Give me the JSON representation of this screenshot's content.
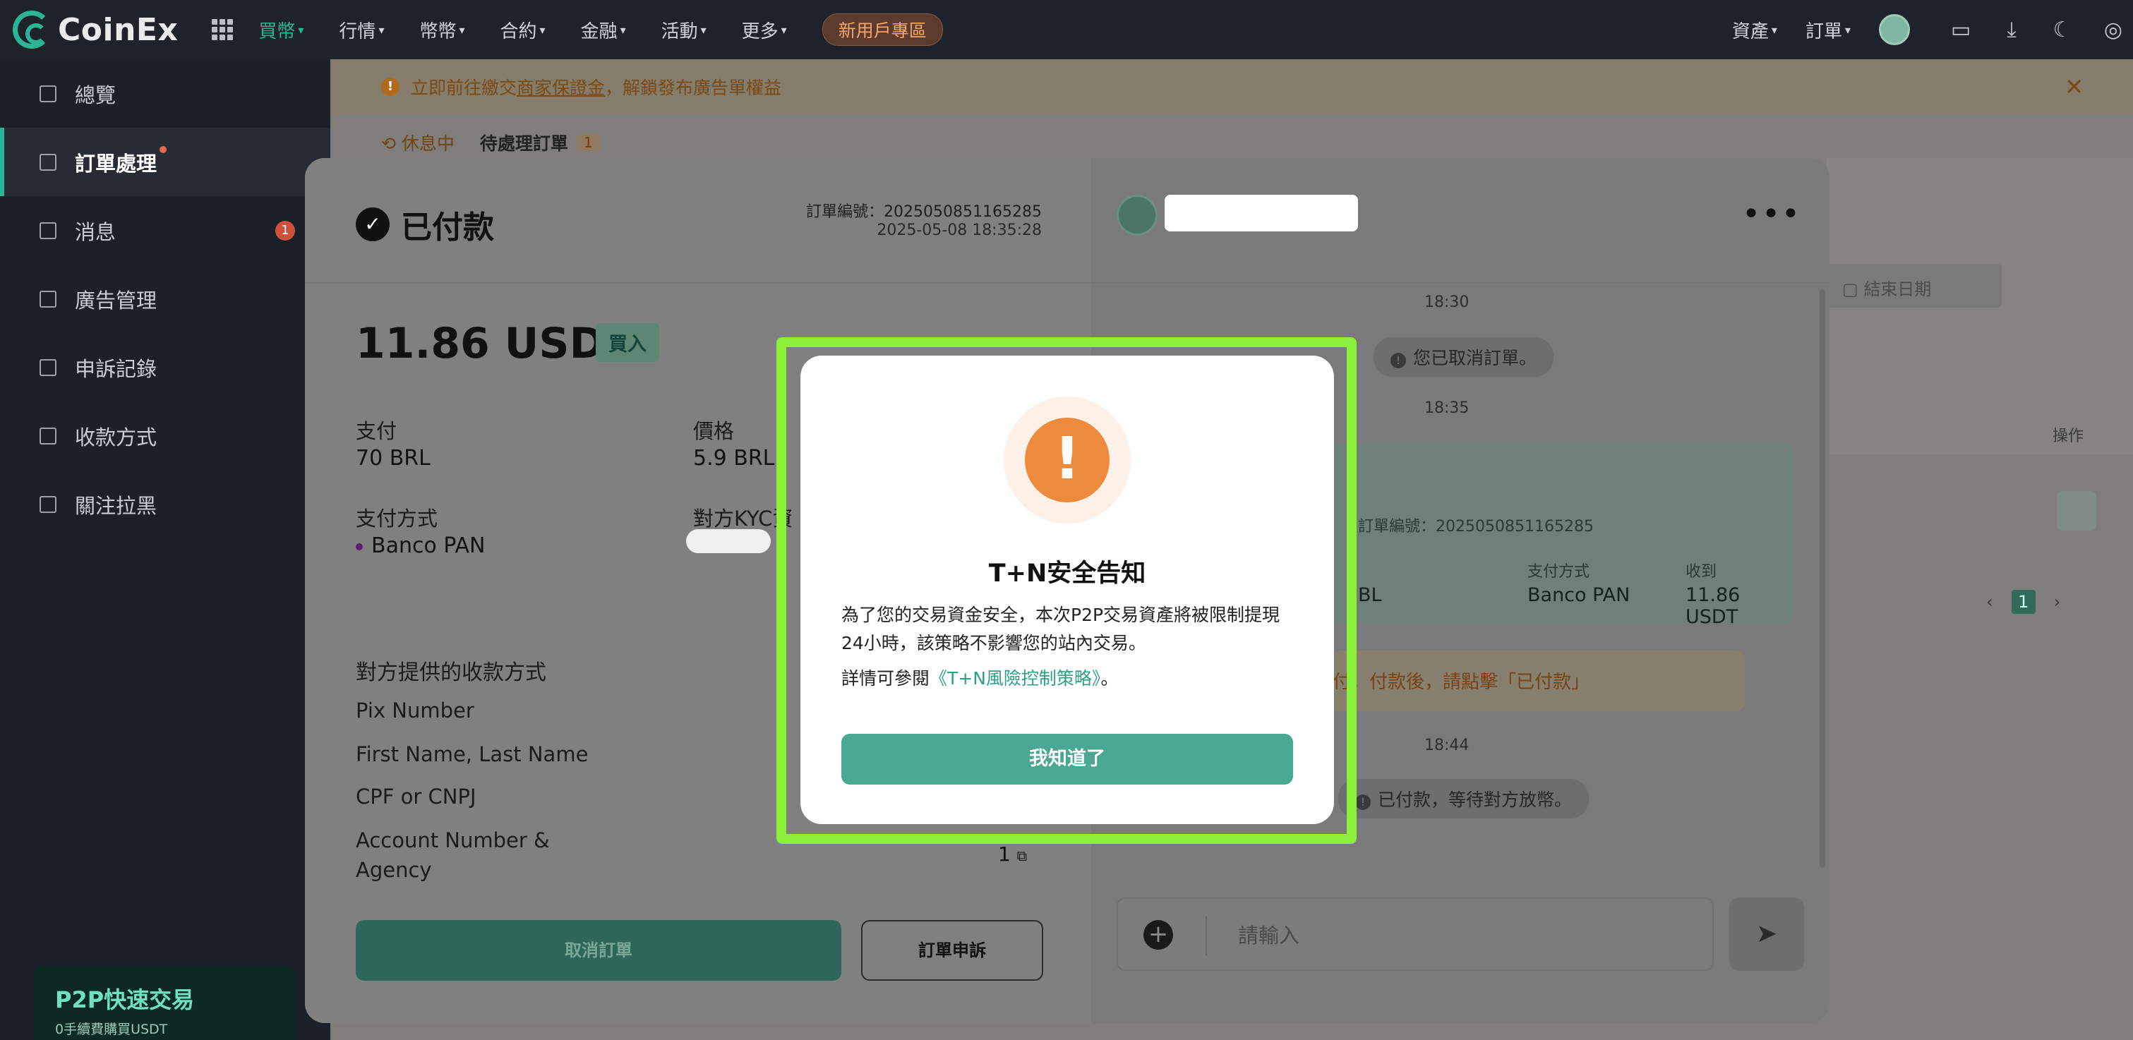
{
  "brand": "CoinEx",
  "topnav": {
    "items": [
      {
        "label": "買幣",
        "active": true
      },
      {
        "label": "行情",
        "active": false
      },
      {
        "label": "幣幣",
        "active": false
      },
      {
        "label": "合約",
        "active": false
      },
      {
        "label": "金融",
        "active": false
      },
      {
        "label": "活動",
        "active": false
      },
      {
        "label": "更多",
        "active": false
      }
    ],
    "new_user": "新用戶專區",
    "right": {
      "assets": "資產",
      "orders": "訂單"
    }
  },
  "sidebar": {
    "items": [
      {
        "label": "總覽"
      },
      {
        "label": "訂單處理"
      },
      {
        "label": "消息",
        "badge": "1"
      },
      {
        "label": "廣告管理"
      },
      {
        "label": "申訴記錄"
      },
      {
        "label": "收款方式"
      },
      {
        "label": "關注拉黑"
      }
    ],
    "promo": {
      "title": "P2P快速交易",
      "subtitle": "0手續費購買USDT"
    }
  },
  "notice": {
    "prefix": "立即前往繳交",
    "link": "商家保證金",
    "suffix": "，解鎖發布廣告單權益"
  },
  "status": {
    "rest": "休息中",
    "pending": "待處理訂單",
    "pending_count": "1"
  },
  "background": {
    "end_date": "結束日期",
    "operation": "操作",
    "page": "1"
  },
  "order": {
    "status_title": "已付款",
    "order_no": "訂單編號：2025050851165285",
    "time": "2025-05-08 18:35:28",
    "amount": "11.86 USDT",
    "side": "買入",
    "pay_label": "支付",
    "pay_value": "70 BRL",
    "price_label": "價格",
    "price_value": "5.9 BRL",
    "method_label": "支付方式",
    "method_value": "Banco PAN",
    "kyc_label": "對方KYC資",
    "payee_title": "對方提供的收款方式",
    "fields": [
      "Pix Number",
      "First Name, Last Name",
      "CPF or CNPJ",
      "Account Number &",
      "Agency"
    ],
    "account_value": "1",
    "cancel": "取消訂單",
    "appeal": "訂單申訴"
  },
  "chat": {
    "times": [
      "18:30",
      "18:35",
      "18:44"
    ],
    "msg_cancel": "您已取消訂單。",
    "card": {
      "order_no": "訂單編號：2025050851165285",
      "left_value": "BL",
      "method_label": "支付方式",
      "method_value": "Banco PAN",
      "receive_label": "收到",
      "receive_value": "11.86 USDT"
    },
    "warn": "訂單待支付，付款後，請點擊「已付款」",
    "msg_paid": "已付款，等待對方放幣。",
    "input_placeholder": "請輸入"
  },
  "modal": {
    "title": "T+N安全告知",
    "body": "為了您的交易資金安全，本次P2P交易資產將被限制提現24小時，該策略不影響您的站內交易。",
    "detail_prefix": "詳情可參閱",
    "detail_link": "《T+N風險控制策略》",
    "detail_suffix": "。",
    "button": "我知道了"
  },
  "colors": {
    "accent": "#2bb596",
    "warning": "#ee8a3d",
    "highlight": "#8af03a",
    "modal_button": "#4aa792"
  }
}
